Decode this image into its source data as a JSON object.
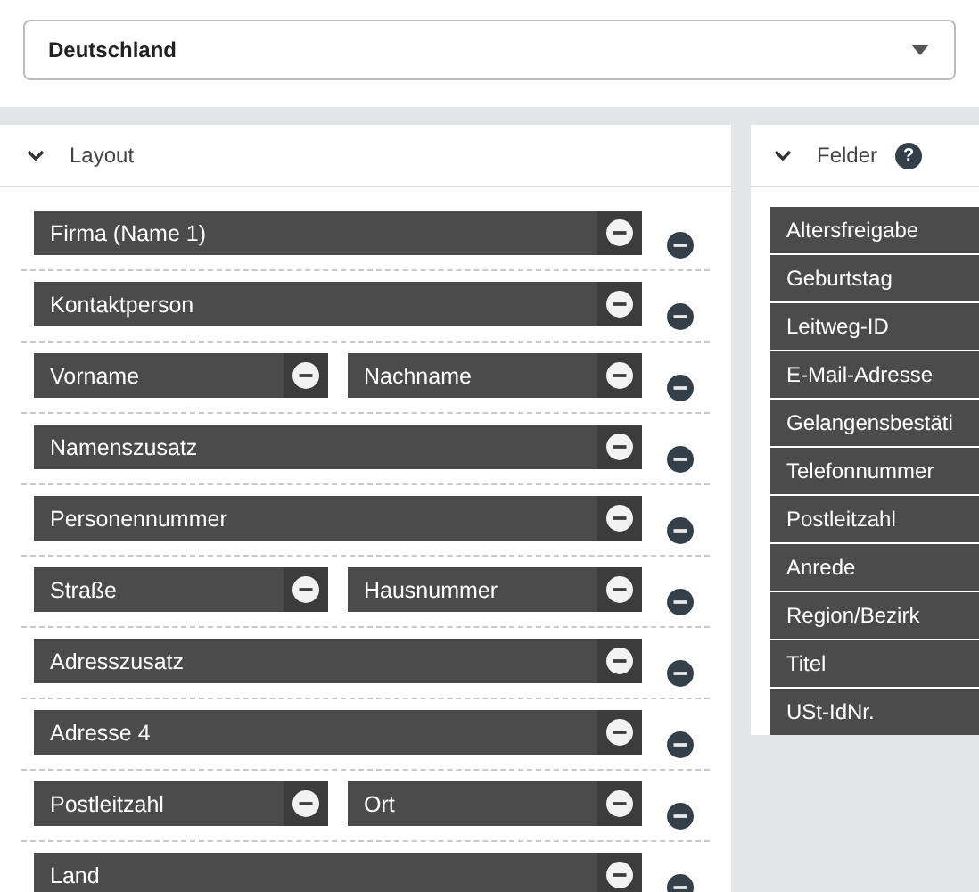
{
  "country_select": {
    "value": "Deutschland"
  },
  "layout_panel": {
    "title": "Layout",
    "expanded": true,
    "rows": [
      {
        "fields": [
          "Firma (Name 1)"
        ]
      },
      {
        "fields": [
          "Kontaktperson"
        ]
      },
      {
        "fields": [
          "Vorname",
          "Nachname"
        ]
      },
      {
        "fields": [
          "Namenszusatz"
        ]
      },
      {
        "fields": [
          "Personennummer"
        ]
      },
      {
        "fields": [
          "Straße",
          "Hausnummer"
        ]
      },
      {
        "fields": [
          "Adresszusatz"
        ]
      },
      {
        "fields": [
          "Adresse 4"
        ]
      },
      {
        "fields": [
          "Postleitzahl",
          "Ort"
        ]
      },
      {
        "fields": [
          "Land"
        ]
      }
    ]
  },
  "fields_panel": {
    "title": "Felder",
    "expanded": true,
    "help": "?",
    "items": [
      "Altersfreigabe",
      "Geburtstag",
      "Leitweg-ID",
      "E-Mail-Adresse",
      "Gelangensbestäti",
      "Telefonnummer",
      "Postleitzahl",
      "Anrede",
      "Region/Bezirk",
      "Titel",
      "USt-IdNr."
    ]
  }
}
